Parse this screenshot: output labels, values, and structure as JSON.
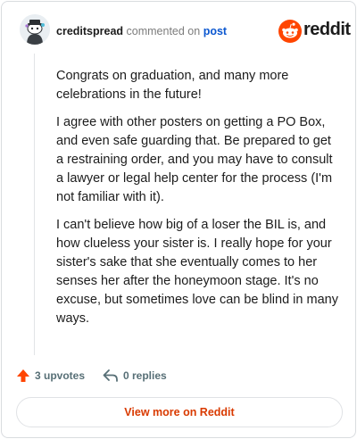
{
  "header": {
    "username": "creditspread",
    "action_text": "commented on",
    "target_link": "post",
    "brand": "reddit"
  },
  "comment": {
    "paragraphs": [
      "Congrats on graduation, and many more celebrations in the future!",
      "I agree with other posters on getting a PO Box, and even safe guarding that. Be prepared to get a restraining order, and you may have to consult a lawyer or legal help center for the process (I'm not familiar with it).",
      "I can't believe how big of a loser the BIL is, and how clueless your sister is. I really hope for your sister's sake that she eventually comes to her senses her after the honeymoon stage. It's no excuse, but sometimes love can be blind in many ways."
    ]
  },
  "actions": {
    "upvotes_label": "3 upvotes",
    "replies_label": "0 replies"
  },
  "footer": {
    "view_more_label": "View more on Reddit"
  },
  "colors": {
    "accent": "#ff4500",
    "link": "#0b57d0",
    "button_text": "#d93a00",
    "muted": "#576f76"
  },
  "icons": {
    "avatar": "snoo-avatar-icon",
    "brand": "reddit-logo-icon",
    "upvote": "upvote-arrow-icon",
    "reply": "reply-arrow-icon"
  }
}
